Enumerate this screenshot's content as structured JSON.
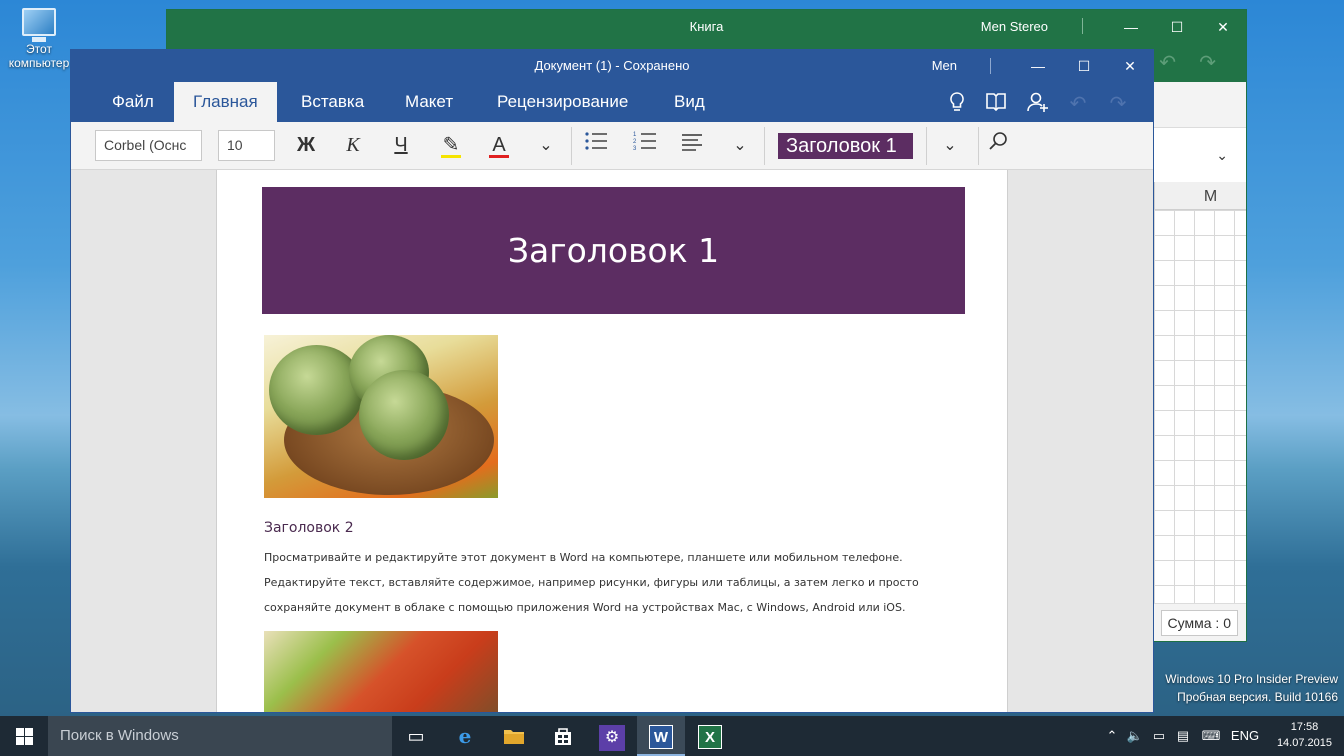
{
  "desktop": {
    "icon_label_line1": "Этот",
    "icon_label_line2": "компьютер",
    "watermark_line1": "Windows 10 Pro Insider Preview",
    "watermark_line2": "Пробная версия. Build 10166"
  },
  "excel": {
    "title": "Книга",
    "user": "Men Stereo",
    "column_header": "M",
    "status_sum": "Сумма : 0"
  },
  "word": {
    "title": "Документ (1) - Сохранено",
    "user": "Men",
    "tabs": [
      {
        "label": "Файл"
      },
      {
        "label": "Главная"
      },
      {
        "label": "Вставка"
      },
      {
        "label": "Макет"
      },
      {
        "label": "Рецензирование"
      },
      {
        "label": "Вид"
      }
    ],
    "toolbar": {
      "font_name": "Corbel (Оснс",
      "font_size": "10",
      "bold": "Ж",
      "italic": "К",
      "underline": "Ч",
      "font_color_letter": "А",
      "style_value": "Заголовок 1",
      "highlight_color": "#f5e400",
      "font_color": "#e02020"
    },
    "document": {
      "heading1": "Заголовок 1",
      "heading2": "Заголовок 2",
      "paragraph_line1": "Просматривайте и редактируйте этот документ в Word на компьютере, планшете или мобильном телефоне.",
      "paragraph_line2": "Редактируйте текст, вставляйте содержимое, например рисунки, фигуры или таблицы, а затем легко и просто",
      "paragraph_line3": "сохраняйте документ в облаке с помощью приложения Word на устройствах Mac, с Windows, Android или iOS."
    },
    "accent_color": "#2b579a",
    "heading_color": "#5c2d62"
  },
  "taskbar": {
    "search_placeholder": "Поиск в Windows",
    "language": "ENG",
    "time": "17:58",
    "date": "14.07.2015"
  }
}
